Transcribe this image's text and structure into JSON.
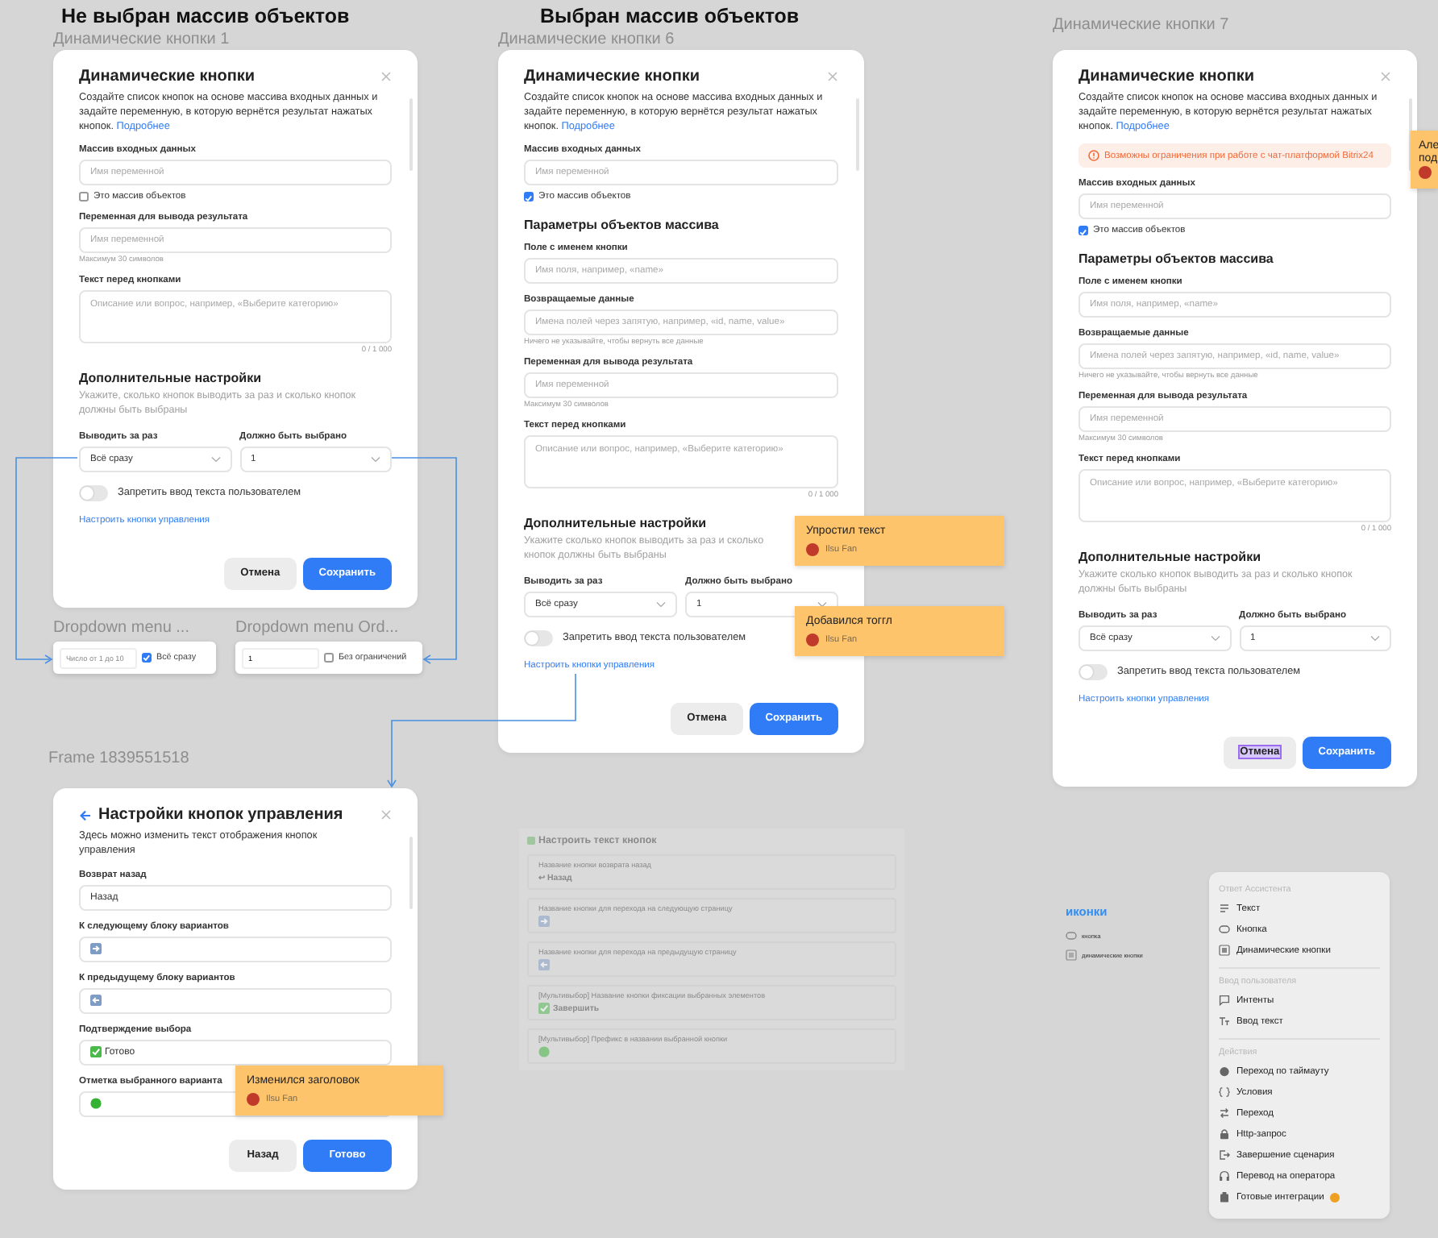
{
  "frames": [
    {
      "heading": "Не выбран массив объектов",
      "label": "Динамические кнопки 1",
      "dialog": {
        "back": false,
        "title": "Динамические кнопки",
        "description": "Создайте список кнопок на основе массива входных данных и задайте переменную, в которую вернётся результат нажатых кнопок.",
        "link": "Подробнее",
        "blocks": [
          {
            "kind": "field",
            "label": "Массив входных данных",
            "placeholder": "Имя переменной"
          },
          {
            "kind": "checkbox",
            "label": "Это массив объектов",
            "checked": false
          },
          {
            "kind": "field",
            "label": "Переменная для вывода результата",
            "placeholder": "Имя переменной",
            "hint": "Максимум 30 символов"
          },
          {
            "kind": "textarea",
            "label": "Текст перед кнопками",
            "placeholder": "Описание или вопрос, например, «Выберите категорию»",
            "counter": "0 / 1 000"
          },
          {
            "kind": "heading",
            "text": "Дополнительные настройки"
          },
          {
            "kind": "note",
            "text": "Укажите, сколько кнопок выводить за раз и сколько кнопок должны быть выбраны"
          },
          {
            "kind": "selects",
            "items": [
              {
                "label": "Выводить за раз",
                "value": "Всё сразу"
              },
              {
                "label": "Должно быть выбрано",
                "value": "1"
              }
            ]
          },
          {
            "kind": "toggle",
            "label": "Запретить ввод текста пользователем",
            "on": false
          },
          {
            "kind": "link",
            "text": "Настроить кнопки управления"
          }
        ],
        "buttons": [
          {
            "label": "Отмена",
            "kind": "secondary",
            "highlighted": false
          },
          {
            "label": "Сохранить",
            "kind": "primary",
            "highlighted": false
          }
        ]
      }
    },
    {
      "heading": "Выбран массив объектов",
      "label": "Динамические кнопки 6",
      "dialog": {
        "back": false,
        "title": "Динамические кнопки",
        "description": "Создайте список кнопок на основе массива входных данных и задайте переменную, в которую вернётся результат нажатых кнопок.",
        "link": "Подробнее",
        "blocks": [
          {
            "kind": "field",
            "label": "Массив входных данных",
            "placeholder": "Имя переменной"
          },
          {
            "kind": "checkbox",
            "label": "Это массив объектов",
            "checked": true
          },
          {
            "kind": "heading",
            "text": "Параметры объектов массива"
          },
          {
            "kind": "field",
            "label": "Поле с именем кнопки",
            "placeholder": "Имя поля, например, «name»"
          },
          {
            "kind": "field",
            "label": "Возвращаемые данные",
            "placeholder": "Имена полей через запятую, например, «id, name, value»",
            "hint": "Ничего не указывайте, чтобы вернуть все данные"
          },
          {
            "kind": "field",
            "label": "Переменная для вывода результата",
            "placeholder": "Имя переменной",
            "hint": "Максимум 30 символов"
          },
          {
            "kind": "textarea",
            "label": "Текст перед кнопками",
            "placeholder": "Описание или вопрос, например, «Выберите категорию»",
            "counter": "0 / 1 000"
          },
          {
            "kind": "heading",
            "text": "Дополнительные настройки"
          },
          {
            "kind": "note",
            "text": "Укажите сколько кнопок выводить за раз и сколько кнопок должны быть выбраны"
          },
          {
            "kind": "selects",
            "items": [
              {
                "label": "Выводить за раз",
                "value": "Всё сразу"
              },
              {
                "label": "Должно быть выбрано",
                "value": "1"
              }
            ]
          },
          {
            "kind": "toggle",
            "label": "Запретить ввод текста пользователем",
            "on": false
          },
          {
            "kind": "link",
            "text": "Настроить кнопки управления"
          }
        ],
        "buttons": [
          {
            "label": "Отмена",
            "kind": "secondary",
            "highlighted": false
          },
          {
            "label": "Сохранить",
            "kind": "primary",
            "highlighted": false
          }
        ]
      }
    },
    {
      "label": "Динамические кнопки 7",
      "dialog": {
        "back": false,
        "title": "Динамические кнопки",
        "description": "Создайте список кнопок на основе массива входных данных и задайте переменную, в которую вернётся результат нажатых кнопок.",
        "link": "Подробнее",
        "blocks": [
          {
            "kind": "alert",
            "text": "Возможны ограничения при работе с чат-платформой Bitrix24"
          },
          {
            "kind": "field",
            "label": "Массив входных данных",
            "placeholder": "Имя переменной"
          },
          {
            "kind": "checkbox",
            "label": "Это массив объектов",
            "checked": true
          },
          {
            "kind": "heading",
            "text": "Параметры объектов массива"
          },
          {
            "kind": "field",
            "label": "Поле с именем кнопки",
            "placeholder": "Имя поля, например, «name»"
          },
          {
            "kind": "field",
            "label": "Возвращаемые данные",
            "placeholder": "Имена полей через запятую, например, «id, name, value»",
            "hint": "Ничего не указывайте, чтобы вернуть все данные"
          },
          {
            "kind": "field",
            "label": "Переменная для вывода результата",
            "placeholder": "Имя переменной",
            "hint": "Максимум 30 символов"
          },
          {
            "kind": "textarea",
            "label": "Текст перед кнопками",
            "placeholder": "Описание или вопрос, например, «Выберите категорию»",
            "counter": "0 / 1 000"
          },
          {
            "kind": "heading",
            "text": "Дополнительные настройки"
          },
          {
            "kind": "note",
            "text": "Укажите сколько кнопок выводить за раз и сколько кнопок должны быть выбраны"
          },
          {
            "kind": "selects",
            "items": [
              {
                "label": "Выводить за раз",
                "value": "Всё сразу"
              },
              {
                "label": "Должно быть выбрано",
                "value": "1"
              }
            ]
          },
          {
            "kind": "toggle",
            "label": "Запретить ввод текста пользователем",
            "on": false
          },
          {
            "kind": "link",
            "text": "Настроить кнопки управления"
          }
        ],
        "buttons": [
          {
            "label": "Отмена",
            "kind": "secondary",
            "highlighted": true
          },
          {
            "label": "Сохранить",
            "kind": "primary",
            "highlighted": false
          }
        ]
      }
    },
    {
      "label": "Frame 1839551518",
      "dialog": {
        "back": true,
        "title": "Настройки кнопок управления",
        "description": "Здесь можно изменить текст отображения кнопок управления",
        "blocks": [
          {
            "kind": "text",
            "label": "Возврат назад",
            "value": "Назад"
          },
          {
            "kind": "next",
            "label": "К следующему блоку вариантов"
          },
          {
            "kind": "prev",
            "label": "К предыдущему блоку вариантов"
          },
          {
            "kind": "confirm",
            "label": "Подтверждение выбора",
            "value": "Готово"
          },
          {
            "kind": "mark",
            "label": "Отметка выбранного варианта"
          }
        ],
        "buttons": [
          {
            "label": "Назад",
            "kind": "secondary",
            "highlighted": false
          },
          {
            "label": "Готово",
            "kind": "primary",
            "highlighted": false
          }
        ]
      }
    }
  ],
  "dropdowns": [
    {
      "label": "Dropdown menu ...",
      "placeholder": "Число от 1 до 10",
      "checkbox": "Всё сразу",
      "checked": true
    },
    {
      "label": "Dropdown menu Ord...",
      "value": "1",
      "checkbox": "Без ограничений",
      "checked": false
    }
  ],
  "comments": [
    {
      "lines": [
        "Упростил текст"
      ],
      "author": "Ilsu Fan"
    },
    {
      "lines": [
        "Добавился тоггл"
      ],
      "author": "Ilsu Fan"
    },
    {
      "lines": [
        "Але",
        "под"
      ]
    },
    {
      "lines": [
        "Изменился заголовок"
      ],
      "author": "Ilsu Fan"
    }
  ],
  "faded_panel": {
    "title": "Настроить текст кнопок",
    "items": [
      {
        "kind": "text",
        "label": "Название кнопки возврата назад",
        "value": "↩ Назад"
      },
      {
        "kind": "next",
        "label": "Название кнопки для перехода на следующую страницу"
      },
      {
        "kind": "prev",
        "label": "Название кнопки для перехода на предыдущую страницу"
      },
      {
        "kind": "confirm",
        "label": "[Мультивыбор] Название кнопки фиксации выбранных элементов",
        "value": "Завершить"
      },
      {
        "kind": "mark",
        "label": "[Мультивыбор] Префикс в названии выбранной кнопки"
      }
    ]
  },
  "icons": {
    "title": "иконки",
    "items": [
      "кнопка",
      "динамические кнопки"
    ]
  },
  "menu": {
    "sections": [
      {
        "title": "Ответ Ассистента",
        "items": [
          {
            "label": "Текст",
            "badge": false
          },
          {
            "label": "Кнопка",
            "badge": false
          },
          {
            "label": "Динамические кнопки",
            "badge": false
          }
        ]
      },
      {
        "title": "Ввод пользователя",
        "items": [
          {
            "label": "Интенты",
            "badge": false
          },
          {
            "label": "Ввод текст",
            "badge": false
          }
        ]
      },
      {
        "title": "Действия",
        "items": [
          {
            "label": "Переход по таймауту",
            "badge": false
          },
          {
            "label": "Условия",
            "badge": false
          },
          {
            "label": "Переход",
            "badge": false
          },
          {
            "label": "Http-запрос",
            "badge": false
          },
          {
            "label": "Завершение сценария",
            "badge": false
          },
          {
            "label": "Перевод на оператора",
            "badge": false
          },
          {
            "label": "Готовые интеграции",
            "badge": true
          }
        ]
      }
    ]
  }
}
